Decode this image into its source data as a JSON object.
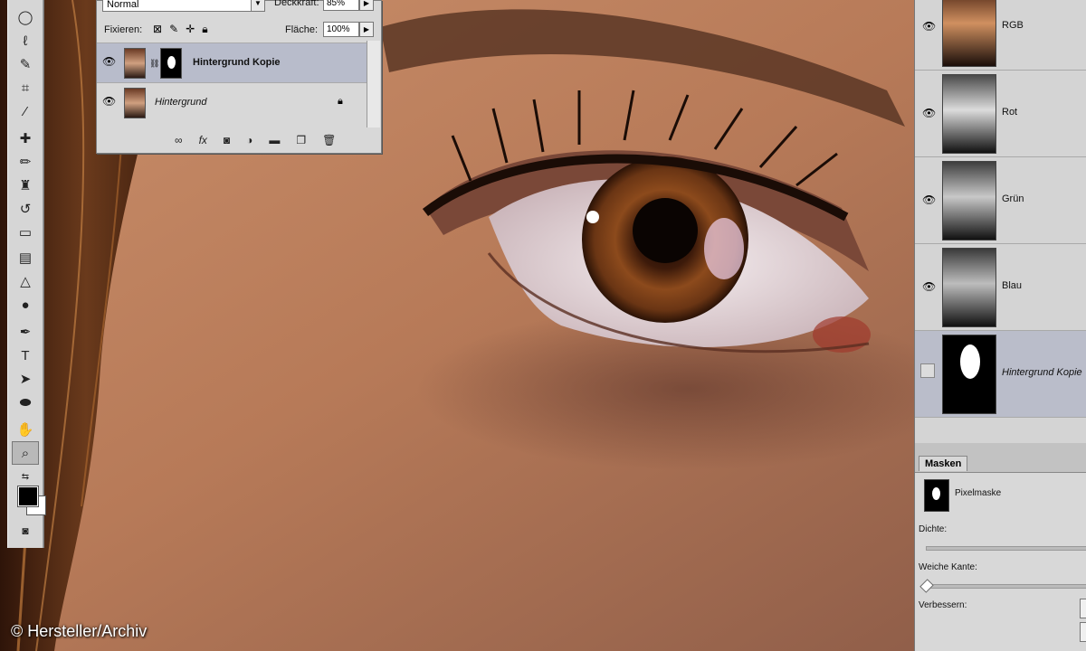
{
  "layers_panel": {
    "blend_mode": "Normal",
    "opacity_label": "Deckkraft:",
    "opacity_value": "85%",
    "lock_label": "Fixieren:",
    "fill_label": "Fläche:",
    "fill_value": "100%",
    "layers": [
      {
        "name": "Hintergrund Kopie",
        "selected": true,
        "has_mask": true
      },
      {
        "name": "Hintergrund",
        "selected": false,
        "locked": true
      }
    ]
  },
  "channels_panel": {
    "channels": [
      {
        "name": "RGB",
        "tint": "color"
      },
      {
        "name": "Rot",
        "tint": "gray"
      },
      {
        "name": "Grün",
        "tint": "gray"
      },
      {
        "name": "Blau",
        "tint": "gray"
      },
      {
        "name": "Hintergrund Kopie",
        "tint": "mask",
        "selected": true
      }
    ]
  },
  "masks_panel": {
    "tab": "Masken",
    "mask_type": "Pixelmaske",
    "density_label": "Dichte:",
    "feather_label": "Weiche Kante:",
    "refine_label": "Verbessern:"
  },
  "watermark": "© Hersteller/Archiv",
  "colors": {
    "selection": "#b8bccb",
    "panel": "#d8d8d8",
    "foreground": "#000000",
    "background": "#ffffff"
  }
}
